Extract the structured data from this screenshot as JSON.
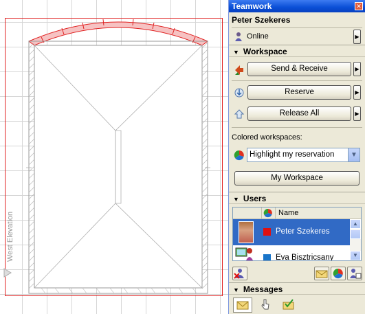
{
  "canvas": {
    "elevation_label": "West Elevation"
  },
  "panel": {
    "title": "Teamwork",
    "user_name": "Peter Szekeres",
    "status": "Online",
    "workspace": {
      "heading": "Workspace",
      "send_receive_label": "Send & Receive",
      "reserve_label": "Reserve",
      "release_all_label": "Release All"
    },
    "colored": {
      "label": "Colored workspaces:",
      "selected": "Highlight my reservation",
      "my_workspace_label": "My Workspace"
    },
    "users": {
      "heading": "Users",
      "column_name": "Name",
      "rows": [
        {
          "name": "Peter Szekeres",
          "color": "#e01010"
        },
        {
          "name": "Eva Bisztricsany",
          "color": "#1a75c9"
        }
      ]
    },
    "messages": {
      "heading": "Messages"
    }
  },
  "colors": {
    "accent": "#316ac5",
    "reservation_red": "#e01010"
  }
}
